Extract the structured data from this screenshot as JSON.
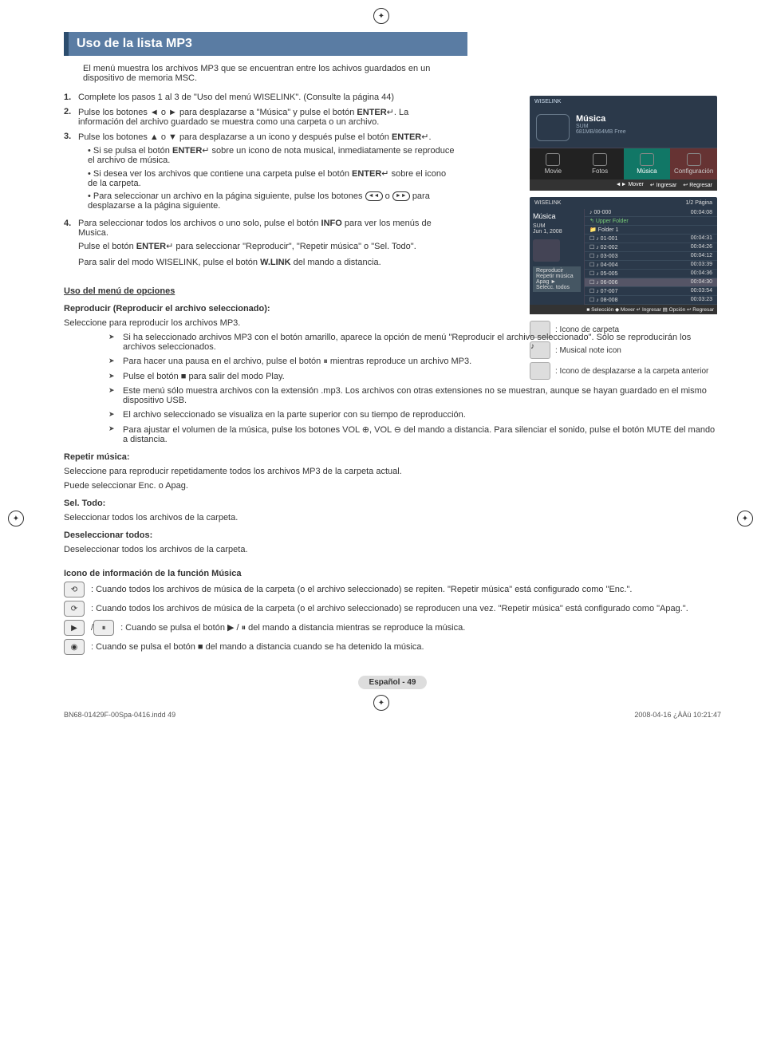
{
  "title": "Uso de la lista MP3",
  "intro": "El menú muestra los archivos MP3 que se encuentran entre los achivos guardados en un dispositivo de memoria MSC.",
  "steps": [
    {
      "n": "1.",
      "text": "Complete los pasos 1 al 3 de \"Uso del menú WISELINK\". (Consulte la página 44)"
    },
    {
      "n": "2.",
      "text_a": "Pulse los botones ◄ o ► para desplazarse a \"Música\" y pulse el botón ",
      "bold1": "ENTER",
      "enter_icon": "↵",
      "text_b": ". La información del archivo guardado se muestra como una carpeta o un archivo."
    },
    {
      "n": "3.",
      "text_a": "Pulse los botones ▲ o ▼ para desplazarse a un icono y después pulse el botón ",
      "bold1": "ENTER",
      "enter_icon": "↵",
      "text_b": ".",
      "subs": [
        {
          "t": "• Si se pulsa el botón ",
          "b": "ENTER",
          "i": "↵",
          "t2": " sobre un icono de nota musical, inmediatamente se reproduce el archivo de música."
        },
        {
          "t": "• Si desea ver los archivos que contiene una carpeta pulse el botón ",
          "b": "ENTER",
          "i": "↵",
          "t2": " sobre el icono de la carpeta."
        },
        {
          "t": "• Para seleccionar un archivo en la página siguiente, pulse los botones ",
          "rew": "◄◄",
          "ff": "►►",
          "t2": " para desplazarse a la página siguiente."
        }
      ]
    },
    {
      "n": "4.",
      "text_a": "Para seleccionar todos los archivos o uno solo, pulse el botón ",
      "bold1": "INFO",
      "text_b": " para ver los menús de Musica.",
      "line2_a": "Pulse el botón ",
      "line2_b": "ENTER",
      "line2_i": "↵",
      "line2_c": " para seleccionar \"Reproducir\", \"Repetir música\" o \"Sel. Todo\".",
      "line3_a": "Para salir del modo WISELINK, pulse el botón ",
      "line3_b": "W.LINK",
      "line3_c": " del mando a distancia."
    }
  ],
  "right_panel1": {
    "brand": "WISELINK",
    "title": "Música",
    "sub": "SUM",
    "free": "681MB/864MB Free",
    "tabs": [
      "Movie",
      "Fotos",
      "Música",
      "Configuración"
    ],
    "btns": [
      "◄► Mover",
      "↵ Ingresar",
      "↩ Regresar"
    ]
  },
  "right_panel2": {
    "brand": "WISELINK",
    "cat": "Música",
    "date": "Jun 1, 2008",
    "device": "SUM",
    "pg": "1/2 Página",
    "range": "00-000",
    "total": "00:04:08",
    "rows": [
      {
        "name": "Upper Folder",
        "time": ""
      },
      {
        "name": "Folder 1",
        "time": ""
      },
      {
        "name": "01-001",
        "time": "00:04:31"
      },
      {
        "name": "02-002",
        "time": "00:04:26"
      },
      {
        "name": "03-003",
        "time": "00:04:12"
      },
      {
        "name": "04-004",
        "time": "00:03:39"
      },
      {
        "name": "05-005",
        "time": "00:04:36"
      },
      {
        "name": "06-006",
        "time": "00:04:30"
      },
      {
        "name": "07-007",
        "time": "00:03:54"
      },
      {
        "name": "08-008",
        "time": "00:03:23"
      }
    ],
    "menu": [
      "Reproducir",
      "Repetir música   Apag ►",
      "Selecc. todos"
    ],
    "foot": "■ Selección  ◆ Mover  ↵ Ingresar  ▤ Opción  ↩ Regresar"
  },
  "legend": [
    ": Icono de carpeta",
    ": Musical note icon",
    ": Icono de desplazarse a la carpeta anterior"
  ],
  "options_h": "Uso del menú de opciones",
  "opt1_h": "Reproducir (Reproducir el archivo seleccionado):",
  "opt1_p": "Seleccione para reproducir los archivos MP3.",
  "opt1_bullets": [
    "Si ha seleccionado archivos MP3 con el botón amarillo, aparece la opción de menú \"Reproducir el archivo seleccionado\". Sólo se reproducirán los archivos seleccionados.",
    "Para hacer una pausa en el archivo, pulse el botón ⏸ mientras reproduce un archivo MP3.",
    "Pulse el botón ■ para salir del modo Play.",
    "Este menú sólo muestra archivos con la extensión .mp3. Los archivos con otras extensiones no se muestran, aunque se hayan guardado en el mismo dispositivo USB.",
    "El archivo seleccionado se visualiza en la parte superior con su tiempo de reproducción.",
    "Para ajustar el volumen de la música, pulse los botones VOL ⊕, VOL ⊖ del mando a distancia. Para silenciar el sonido, pulse el botón MUTE del mando a distancia."
  ],
  "opt2_h": "Repetir música:",
  "opt2_p1": "Seleccione para reproducir repetidamente todos los archivos MP3 de la carpeta actual.",
  "opt2_p2": "Puede seleccionar Enc. o Apag.",
  "opt3_h": "Sel. Todo:",
  "opt3_p": "Seleccionar todos los archivos de la carpeta.",
  "opt4_h": "Deseleccionar todos:",
  "opt4_p": "Deseleccionar todos los archivos de la carpeta.",
  "info_h": "Icono de información de la función Música",
  "info_rows": [
    ": Cuando todos los archivos de música de la carpeta (o el archivo seleccionado) se repiten. \"Repetir música\" está configurado como \"Enc.\".",
    ": Cuando todos los archivos de música de la carpeta  (o el archivo seleccionado) se reproducen una vez. \"Repetir música\" está configurado como  \"Apag.\".",
    ": Cuando se pulsa el botón ▶ / ⏸ del mando a distancia mientras se reproduce la música.",
    ": Cuando se pulsa el botón ■ del mando a distancia cuando se ha detenido la música."
  ],
  "info_icons": [
    "⟲",
    "⟳",
    "▶",
    "◉"
  ],
  "lang_footer": "Español - 49",
  "print_left": "BN68-01429F-00Spa-0416.indd   49",
  "print_right": "2008-04-16   ¿ÀÀü 10:21:47"
}
